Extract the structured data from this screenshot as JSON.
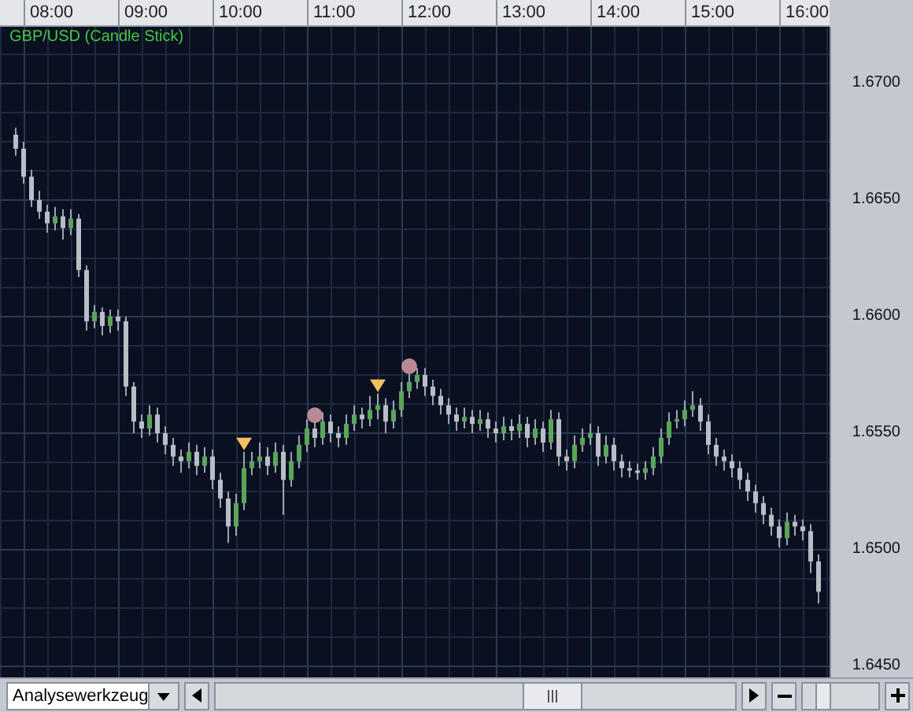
{
  "chart": {
    "chart_data": {
      "type": "candlestick",
      "title": "GBP/USD (Candle Stick)",
      "grid": true,
      "xlim": [
        449,
        976
      ],
      "ylim": [
        1.64453,
        1.67243
      ],
      "xticks": [
        {
          "value": 480,
          "label": "08:00"
        },
        {
          "value": 540,
          "label": "09:00"
        },
        {
          "value": 600,
          "label": "10:00"
        },
        {
          "value": 660,
          "label": "11:00"
        },
        {
          "value": 720,
          "label": "12:00"
        },
        {
          "value": 780,
          "label": "13:00"
        },
        {
          "value": 840,
          "label": "14:00"
        },
        {
          "value": 900,
          "label": "15:00"
        },
        {
          "value": 960,
          "label": "16:00"
        }
      ],
      "yticks": [
        {
          "value": 1.67,
          "label": "1.6700"
        },
        {
          "value": 1.665,
          "label": "1.6650"
        },
        {
          "value": 1.66,
          "label": "1.6600"
        },
        {
          "value": 1.655,
          "label": "1.6550"
        },
        {
          "value": 1.65,
          "label": "1.6500"
        },
        {
          "value": 1.645,
          "label": "1.6450"
        }
      ],
      "x": [
        459,
        464,
        469,
        474,
        479,
        484,
        489,
        494,
        499,
        504,
        509,
        514,
        519,
        524,
        529,
        534,
        539,
        544,
        549,
        554,
        559,
        564,
        569,
        574,
        579,
        584,
        589,
        594,
        599,
        604,
        609,
        614,
        619,
        624,
        629,
        634,
        639,
        644,
        649,
        654,
        659,
        664,
        669,
        674,
        679,
        684,
        689,
        694,
        699,
        704,
        709,
        714,
        719,
        724,
        729,
        734,
        739,
        744,
        749,
        754,
        759,
        764,
        769,
        774,
        779,
        784,
        789,
        794,
        799,
        804,
        809,
        814,
        819,
        824,
        829,
        834,
        839,
        844,
        849,
        854,
        859,
        864,
        869,
        874,
        879,
        884,
        889,
        894,
        899,
        904,
        909,
        914,
        919,
        924,
        929,
        934,
        939,
        944,
        949,
        954,
        959,
        964,
        969
      ],
      "ohlc": [
        [
          1.6678,
          1.6681,
          1.6669,
          1.6672
        ],
        [
          1.6672,
          1.6675,
          1.6657,
          1.666
        ],
        [
          1.666,
          1.6663,
          1.6647,
          1.665
        ],
        [
          1.665,
          1.6654,
          1.6642,
          1.6645
        ],
        [
          1.6645,
          1.6648,
          1.6636,
          1.664
        ],
        [
          1.664,
          1.6647,
          1.6637,
          1.6643
        ],
        [
          1.6643,
          1.6646,
          1.6633,
          1.6638
        ],
        [
          1.6638,
          1.6646,
          1.6635,
          1.6642
        ],
        [
          1.6642,
          1.6644,
          1.6617,
          1.662
        ],
        [
          1.662,
          1.6622,
          1.6594,
          1.6598
        ],
        [
          1.6598,
          1.6605,
          1.6595,
          1.6602
        ],
        [
          1.6602,
          1.6604,
          1.6592,
          1.6596
        ],
        [
          1.6596,
          1.6603,
          1.6593,
          1.66
        ],
        [
          1.66,
          1.6603,
          1.6594,
          1.6598
        ],
        [
          1.6598,
          1.66,
          1.6566,
          1.657
        ],
        [
          1.657,
          1.6572,
          1.655,
          1.6555
        ],
        [
          1.6555,
          1.6558,
          1.6548,
          1.6552
        ],
        [
          1.6552,
          1.6562,
          1.6549,
          1.6558
        ],
        [
          1.6558,
          1.6561,
          1.6546,
          1.655
        ],
        [
          1.655,
          1.6553,
          1.6541,
          1.6545
        ],
        [
          1.6545,
          1.6548,
          1.6536,
          1.654
        ],
        [
          1.654,
          1.6543,
          1.6533,
          1.6538
        ],
        [
          1.6538,
          1.6546,
          1.6535,
          1.6542
        ],
        [
          1.6542,
          1.6545,
          1.6532,
          1.6536
        ],
        [
          1.6536,
          1.6544,
          1.6533,
          1.654
        ],
        [
          1.654,
          1.6543,
          1.6526,
          1.653
        ],
        [
          1.653,
          1.6533,
          1.6518,
          1.6522
        ],
        [
          1.6522,
          1.6525,
          1.6503,
          1.651
        ],
        [
          1.651,
          1.6524,
          1.6506,
          1.652
        ],
        [
          1.652,
          1.6542,
          1.6517,
          1.6535
        ],
        [
          1.6535,
          1.6542,
          1.6532,
          1.6538
        ],
        [
          1.6538,
          1.6546,
          1.6535,
          1.654
        ],
        [
          1.654,
          1.6544,
          1.6532,
          1.6536
        ],
        [
          1.6536,
          1.6546,
          1.6533,
          1.6542
        ],
        [
          1.6542,
          1.6545,
          1.6515,
          1.653
        ],
        [
          1.653,
          1.6542,
          1.6527,
          1.6538
        ],
        [
          1.6538,
          1.6549,
          1.6535,
          1.6545
        ],
        [
          1.6545,
          1.6556,
          1.6542,
          1.6552
        ],
        [
          1.6552,
          1.6555,
          1.6544,
          1.6548
        ],
        [
          1.6548,
          1.6559,
          1.6545,
          1.6555
        ],
        [
          1.6555,
          1.6558,
          1.6546,
          1.655
        ],
        [
          1.655,
          1.6553,
          1.6544,
          1.6548
        ],
        [
          1.6548,
          1.6558,
          1.6545,
          1.6554
        ],
        [
          1.6554,
          1.6562,
          1.6551,
          1.6558
        ],
        [
          1.6558,
          1.6561,
          1.6552,
          1.6556
        ],
        [
          1.6556,
          1.6566,
          1.6553,
          1.656
        ],
        [
          1.656,
          1.6567,
          1.6556,
          1.6562
        ],
        [
          1.6562,
          1.6565,
          1.655,
          1.6555
        ],
        [
          1.6555,
          1.6564,
          1.6552,
          1.656
        ],
        [
          1.656,
          1.6572,
          1.6557,
          1.6568
        ],
        [
          1.6568,
          1.6576,
          1.6565,
          1.6572
        ],
        [
          1.6572,
          1.6578,
          1.6569,
          1.6575
        ],
        [
          1.6575,
          1.6578,
          1.6566,
          1.657
        ],
        [
          1.657,
          1.6573,
          1.6562,
          1.6566
        ],
        [
          1.6566,
          1.6569,
          1.6558,
          1.6562
        ],
        [
          1.6562,
          1.6565,
          1.6554,
          1.6558
        ],
        [
          1.6558,
          1.6561,
          1.6551,
          1.6555
        ],
        [
          1.6555,
          1.6561,
          1.6552,
          1.6557
        ],
        [
          1.6557,
          1.656,
          1.655,
          1.6554
        ],
        [
          1.6554,
          1.656,
          1.6551,
          1.6556
        ],
        [
          1.6556,
          1.6559,
          1.6548,
          1.6552
        ],
        [
          1.6552,
          1.6555,
          1.6546,
          1.655
        ],
        [
          1.655,
          1.6557,
          1.6547,
          1.6553
        ],
        [
          1.6553,
          1.6556,
          1.6547,
          1.6551
        ],
        [
          1.6551,
          1.6558,
          1.6548,
          1.6554
        ],
        [
          1.6554,
          1.6557,
          1.6544,
          1.6548
        ],
        [
          1.6548,
          1.6556,
          1.6545,
          1.6552
        ],
        [
          1.6552,
          1.6555,
          1.6542,
          1.6546
        ],
        [
          1.6546,
          1.656,
          1.6543,
          1.6556
        ],
        [
          1.6556,
          1.6559,
          1.6536,
          1.654
        ],
        [
          1.654,
          1.6543,
          1.6534,
          1.6538
        ],
        [
          1.6538,
          1.6549,
          1.6535,
          1.6545
        ],
        [
          1.6545,
          1.6552,
          1.6542,
          1.6548
        ],
        [
          1.6548,
          1.6554,
          1.6545,
          1.655
        ],
        [
          1.655,
          1.6553,
          1.6536,
          1.654
        ],
        [
          1.654,
          1.6549,
          1.6537,
          1.6545
        ],
        [
          1.6545,
          1.6548,
          1.6534,
          1.6538
        ],
        [
          1.6538,
          1.6541,
          1.6531,
          1.6535
        ],
        [
          1.6535,
          1.6538,
          1.6531,
          1.6534
        ],
        [
          1.6534,
          1.6537,
          1.653,
          1.6533
        ],
        [
          1.6533,
          1.6538,
          1.653,
          1.6535
        ],
        [
          1.6535,
          1.6544,
          1.6532,
          1.654
        ],
        [
          1.654,
          1.6552,
          1.6537,
          1.6548
        ],
        [
          1.6548,
          1.6559,
          1.6545,
          1.6555
        ],
        [
          1.6555,
          1.656,
          1.6552,
          1.6556
        ],
        [
          1.6556,
          1.6564,
          1.6553,
          1.656
        ],
        [
          1.656,
          1.6568,
          1.6557,
          1.6562
        ],
        [
          1.6562,
          1.6565,
          1.6551,
          1.6555
        ],
        [
          1.6555,
          1.6558,
          1.6541,
          1.6545
        ],
        [
          1.6545,
          1.6548,
          1.6536,
          1.654
        ],
        [
          1.654,
          1.6543,
          1.6534,
          1.6538
        ],
        [
          1.6538,
          1.6541,
          1.6531,
          1.6535
        ],
        [
          1.6535,
          1.6538,
          1.6526,
          1.653
        ],
        [
          1.653,
          1.6533,
          1.6521,
          1.6525
        ],
        [
          1.6525,
          1.6528,
          1.6516,
          1.652
        ],
        [
          1.652,
          1.6523,
          1.6511,
          1.6515
        ],
        [
          1.6515,
          1.6518,
          1.6506,
          1.651
        ],
        [
          1.651,
          1.6513,
          1.6501,
          1.6505
        ],
        [
          1.6505,
          1.6516,
          1.6502,
          1.6512
        ],
        [
          1.6512,
          1.6515,
          1.6506,
          1.651
        ],
        [
          1.651,
          1.6513,
          1.6504,
          1.6508
        ],
        [
          1.6508,
          1.6511,
          1.649,
          1.6495
        ],
        [
          1.6495,
          1.6498,
          1.6477,
          1.6482
        ]
      ]
    }
  },
  "toolbar": {
    "tool_select": {
      "value": "Analysewerkzeug"
    },
    "zoom_slider": {
      "level": 0.2
    }
  }
}
